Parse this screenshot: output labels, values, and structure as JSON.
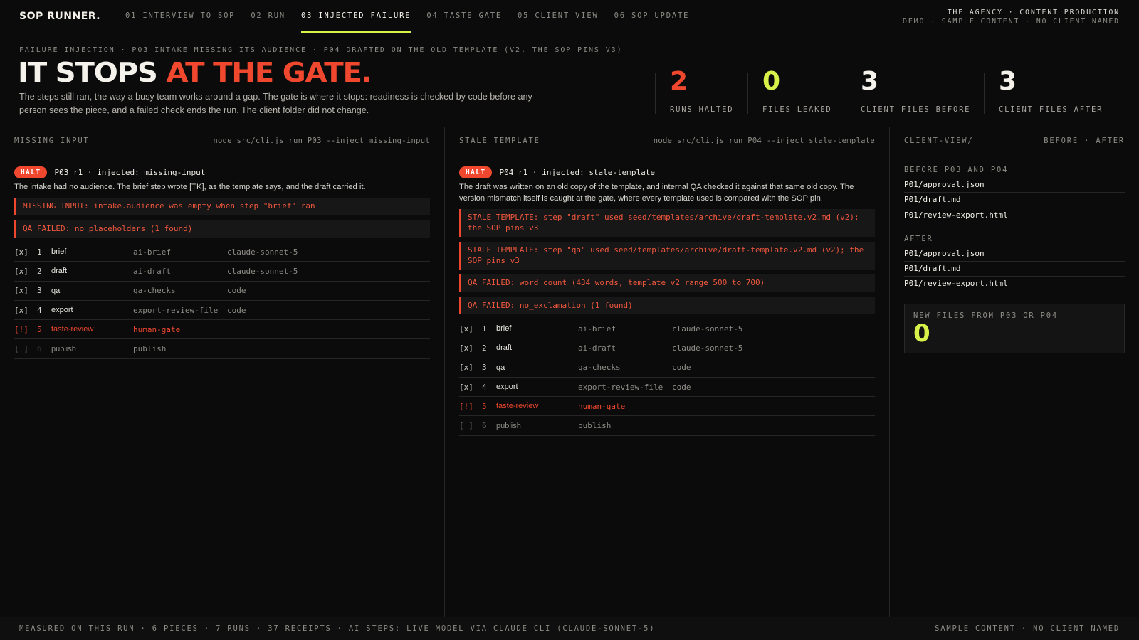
{
  "brand": "SOP RUNNER.",
  "nav": [
    {
      "label": "01 INTERVIEW TO SOP",
      "active": false
    },
    {
      "label": "02 RUN",
      "active": false
    },
    {
      "label": "03 INJECTED FAILURE",
      "active": true
    },
    {
      "label": "04 TASTE GATE",
      "active": false
    },
    {
      "label": "05 CLIENT VIEW",
      "active": false
    },
    {
      "label": "06 SOP UPDATE",
      "active": false
    }
  ],
  "agency": {
    "line1": "THE AGENCY · CONTENT PRODUCTION",
    "line2": "DEMO · SAMPLE CONTENT · NO CLIENT NAMED"
  },
  "hero": {
    "eyebrow": "FAILURE INJECTION · P03 INTAKE MISSING ITS AUDIENCE · P04 DRAFTED ON THE OLD TEMPLATE (V2, THE SOP PINS V3)",
    "title_white": "IT STOPS",
    "title_accent": "AT THE GATE.",
    "lede": "The steps still ran, the way a busy team works around a gap. The gate is where it stops: readiness is checked by code before any person sees the piece, and a failed check ends the run. The client folder did not change."
  },
  "stats": [
    {
      "value": "2",
      "label": "RUNS HALTED",
      "color": "#f0482e"
    },
    {
      "value": "0",
      "label": "FILES LEAKED",
      "color": "#d9f24a"
    },
    {
      "value": "3",
      "label": "CLIENT FILES BEFORE",
      "color": "#f4f2ea"
    },
    {
      "value": "3",
      "label": "CLIENT FILES AFTER",
      "color": "#f4f2ea"
    }
  ],
  "panels": [
    {
      "title": "MISSING INPUT",
      "command": "node src/cli.js run P03 --inject missing-input",
      "badge": "HALT",
      "run": "P03 r1 · injected: missing-input",
      "description": "The intake had no audience. The brief step wrote [TK], as the template says, and the draft carried it.",
      "errors": [
        "MISSING INPUT: intake.audience was empty when step \"brief\" ran",
        "QA FAILED: no_placeholders (1 found)"
      ],
      "steps": [
        {
          "check": "[x]",
          "n": "1",
          "name": "brief",
          "kind": "ai-brief",
          "model": "claude-sonnet-5",
          "state": "done"
        },
        {
          "check": "[x]",
          "n": "2",
          "name": "draft",
          "kind": "ai-draft",
          "model": "claude-sonnet-5",
          "state": "done"
        },
        {
          "check": "[x]",
          "n": "3",
          "name": "qa",
          "kind": "qa-checks",
          "model": "code",
          "state": "done"
        },
        {
          "check": "[x]",
          "n": "4",
          "name": "export",
          "kind": "export-review-file",
          "model": "code",
          "state": "done"
        },
        {
          "check": "[!]",
          "n": "5",
          "name": "taste-review",
          "kind": "human-gate",
          "model": "",
          "state": "fail"
        },
        {
          "check": "[ ]",
          "n": "6",
          "name": "publish",
          "kind": "publish",
          "model": "",
          "state": "todo"
        }
      ]
    },
    {
      "title": "STALE TEMPLATE",
      "command": "node src/cli.js run P04 --inject stale-template",
      "badge": "HALT",
      "run": "P04 r1 · injected: stale-template",
      "description": "The draft was written on an old copy of the template, and internal QA checked it against that same old copy. The version mismatch itself is caught at the gate, where every template used is compared with the SOP pin.",
      "errors": [
        "STALE TEMPLATE: step \"draft\" used seed/templates/archive/draft-template.v2.md (v2); the SOP pins v3",
        "STALE TEMPLATE: step \"qa\" used seed/templates/archive/draft-template.v2.md (v2); the SOP pins v3",
        "QA FAILED: word_count (434 words, template v2 range 500 to 700)",
        "QA FAILED: no_exclamation (1 found)"
      ],
      "steps": [
        {
          "check": "[x]",
          "n": "1",
          "name": "brief",
          "kind": "ai-brief",
          "model": "claude-sonnet-5",
          "state": "done"
        },
        {
          "check": "[x]",
          "n": "2",
          "name": "draft",
          "kind": "ai-draft",
          "model": "claude-sonnet-5",
          "state": "done"
        },
        {
          "check": "[x]",
          "n": "3",
          "name": "qa",
          "kind": "qa-checks",
          "model": "code",
          "state": "done"
        },
        {
          "check": "[x]",
          "n": "4",
          "name": "export",
          "kind": "export-review-file",
          "model": "code",
          "state": "done"
        },
        {
          "check": "[!]",
          "n": "5",
          "name": "taste-review",
          "kind": "human-gate",
          "model": "",
          "state": "fail"
        },
        {
          "check": "[ ]",
          "n": "6",
          "name": "publish",
          "kind": "publish",
          "model": "",
          "state": "todo"
        }
      ]
    }
  ],
  "client_view": {
    "title": "CLIENT-VIEW/",
    "toggle": "BEFORE · AFTER",
    "before_label": "BEFORE P03 AND P04",
    "before_files": [
      "P01/approval.json",
      "P01/draft.md",
      "P01/review-export.html"
    ],
    "after_label": "AFTER",
    "after_files": [
      "P01/approval.json",
      "P01/draft.md",
      "P01/review-export.html"
    ],
    "new_files_label": "NEW FILES FROM P03 OR P04",
    "new_files_value": "0"
  },
  "footer": {
    "left": "MEASURED ON THIS RUN · 6 PIECES · 7 RUNS · 37 RECEIPTS · AI STEPS: LIVE MODEL VIA CLAUDE CLI (CLAUDE-SONNET-5)",
    "right": "SAMPLE CONTENT · NO CLIENT NAMED"
  },
  "colors": {
    "accent_red": "#f0482e",
    "accent_lime": "#d9f24a",
    "background": "#0b0b0b"
  }
}
